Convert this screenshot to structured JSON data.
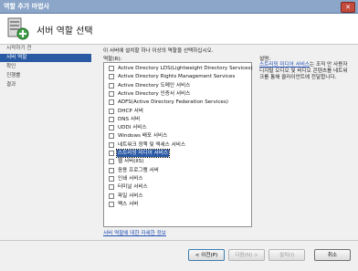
{
  "window": {
    "title": "역할 추가 마법사",
    "close_label": "✕"
  },
  "header": {
    "title": "서버 역할 선택",
    "icon": "server-roles-icon"
  },
  "sidebar": {
    "items": [
      {
        "label": "시작하기 전",
        "active": false
      },
      {
        "label": "서버 역할",
        "active": true
      },
      {
        "label": "확인",
        "active": false
      },
      {
        "label": "진행률",
        "active": false
      },
      {
        "label": "결과",
        "active": false
      }
    ]
  },
  "main": {
    "instruction": "이 서버에 설치할 하나 이상의 역할을 선택하십시오.",
    "roles_label": "역할(R):",
    "roles": [
      "Active Directory LDS(Lightweight Directory Services)",
      "Active Directory Rights Management Services",
      "Active Directory 도메인 서비스",
      "Active Directory 인증서 서비스",
      "ADFS(Active Directory Federation Services)",
      "DHCP 서버",
      "DNS 서버",
      "UDDI 서비스",
      "Windows 배포 서비스",
      "네트워크 정책 및 액세스 서비스",
      "스트리밍 미디어 서비스",
      "웹 서버(IIS)",
      "응용 프로그램 서버",
      "인쇄 서비스",
      "터미널 서비스",
      "파일 서비스",
      "팩스 서버"
    ],
    "selected_index": 10,
    "description_label": "설명:",
    "description_link": "스트리밍 미디어 서비스",
    "description_text": "는 조직 안 사용자 디지털 오디오 및 비디오 콘텐츠를 네트워크를 통해 클라이언트에 전달합니다.",
    "more_link": "서버 역할에 대한 자세한 정보"
  },
  "footer": {
    "prev": "< 이전(P)",
    "next": "다음(N) >",
    "install": "설치(I)",
    "cancel": "취소"
  }
}
